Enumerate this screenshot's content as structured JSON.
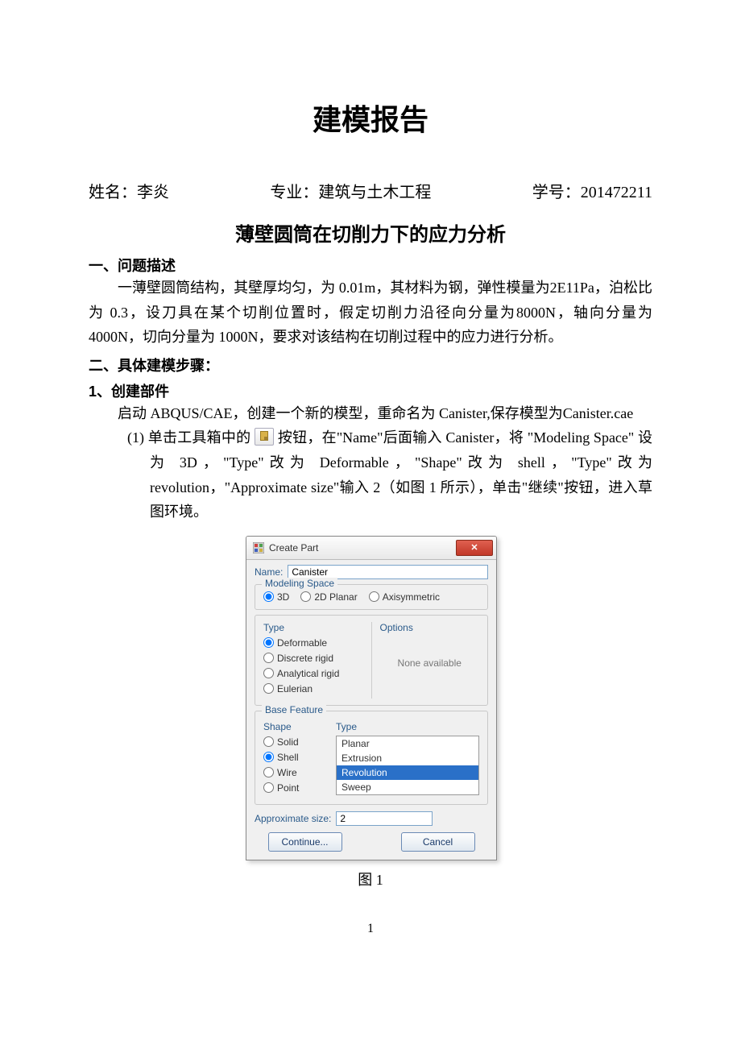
{
  "doc": {
    "title": "建模报告",
    "name_label": "姓名：",
    "name_value": "李炎",
    "major_label": "专业：",
    "major_value": "建筑与土木工程",
    "id_label": "学号：",
    "id_value": "201472211",
    "subtitle": "薄壁圆筒在切削力下的应力分析",
    "sec1_head": "一、问题描述",
    "sec1_body": "一薄壁圆筒结构，其壁厚均匀，为 0.01m，其材料为钢，弹性模量为2E11Pa，泊松比为 0.3，设刀具在某个切削位置时，假定切削力沿径向分量为8000N，轴向分量为 4000N，切向分量为 1000N，要求对该结构在切削过程中的应力进行分析。",
    "sec2_head": "二、具体建模步骤：",
    "sec2_sub1": "1、创建部件",
    "sec2_body": "启动 ABQUS/CAE，创建一个新的模型，重命名为 Canister,保存模型为Canister.cae",
    "step1_prefix": "(1) 单击工具箱中的 ",
    "step1_mid": " 按钮，在\"Name\"后面输入 Canister，将 \"Modeling Space\" 设为 3D，\"Type\"改为 Deformable，\"Shape\"改为 shell，\"Type\"改为 revolution，\"Approximate size\"输入 2（如图 1 所示），单击\"继续\"按钮，进入草图环境。",
    "fig_caption": "图 1",
    "page_num": "1"
  },
  "dialog": {
    "title": "Create Part",
    "close": "✕",
    "name_label": "Name:",
    "name_value": "Canister",
    "modeling_space": {
      "title": "Modeling Space",
      "options": [
        "3D",
        "2D Planar",
        "Axisymmetric"
      ],
      "selected": "3D"
    },
    "type_group": {
      "title": "Type",
      "options": [
        "Deformable",
        "Discrete rigid",
        "Analytical rigid",
        "Eulerian"
      ],
      "selected": "Deformable"
    },
    "options_group": {
      "title": "Options",
      "none": "None available"
    },
    "base_feature": {
      "title": "Base Feature",
      "shape_title": "Shape",
      "shape_options": [
        "Solid",
        "Shell",
        "Wire",
        "Point"
      ],
      "shape_selected": "Shell",
      "type_title": "Type",
      "type_options": [
        "Planar",
        "Extrusion",
        "Revolution",
        "Sweep"
      ],
      "type_selected": "Revolution"
    },
    "approx_label": "Approximate size:",
    "approx_value": "2",
    "continue_btn": "Continue...",
    "cancel_btn": "Cancel"
  }
}
